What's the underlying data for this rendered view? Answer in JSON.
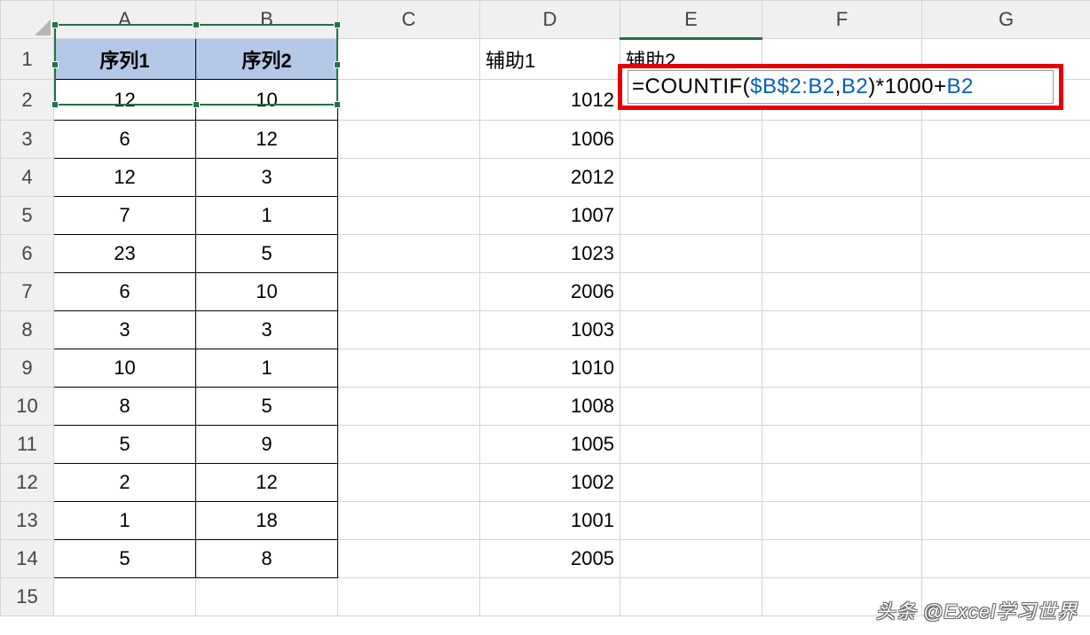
{
  "columns": [
    "A",
    "B",
    "C",
    "D",
    "E",
    "F",
    "G"
  ],
  "rowCount": 15,
  "headers": {
    "A1": "序列1",
    "B1": "序列2",
    "D1": "辅助1",
    "E1": "辅助2"
  },
  "data": {
    "A": [
      12,
      6,
      12,
      7,
      23,
      6,
      3,
      10,
      8,
      5,
      2,
      1,
      5
    ],
    "B": [
      10,
      12,
      3,
      1,
      5,
      10,
      3,
      1,
      5,
      9,
      12,
      18,
      8
    ],
    "D": [
      1012,
      1006,
      2012,
      1007,
      1023,
      2006,
      1003,
      1010,
      1008,
      1005,
      1002,
      1001,
      2005
    ]
  },
  "formula": {
    "cell": "E2",
    "tokens": [
      {
        "t": "=",
        "c": "txt"
      },
      {
        "t": "COUNTIF",
        "c": "fn"
      },
      {
        "t": "(",
        "c": "txt"
      },
      {
        "t": "$B$2:B2",
        "c": "ref"
      },
      {
        "t": ",",
        "c": "txt"
      },
      {
        "t": "B2",
        "c": "ref"
      },
      {
        "t": ")*1000+",
        "c": "txt"
      },
      {
        "t": "B2",
        "c": "ref"
      }
    ],
    "raw": "=COUNTIF($B$2:B2,B2)*1000+B2"
  },
  "selection": {
    "range": "A1:B2"
  },
  "activeColumn": "E",
  "watermark": "头条 @Excel学习世界"
}
